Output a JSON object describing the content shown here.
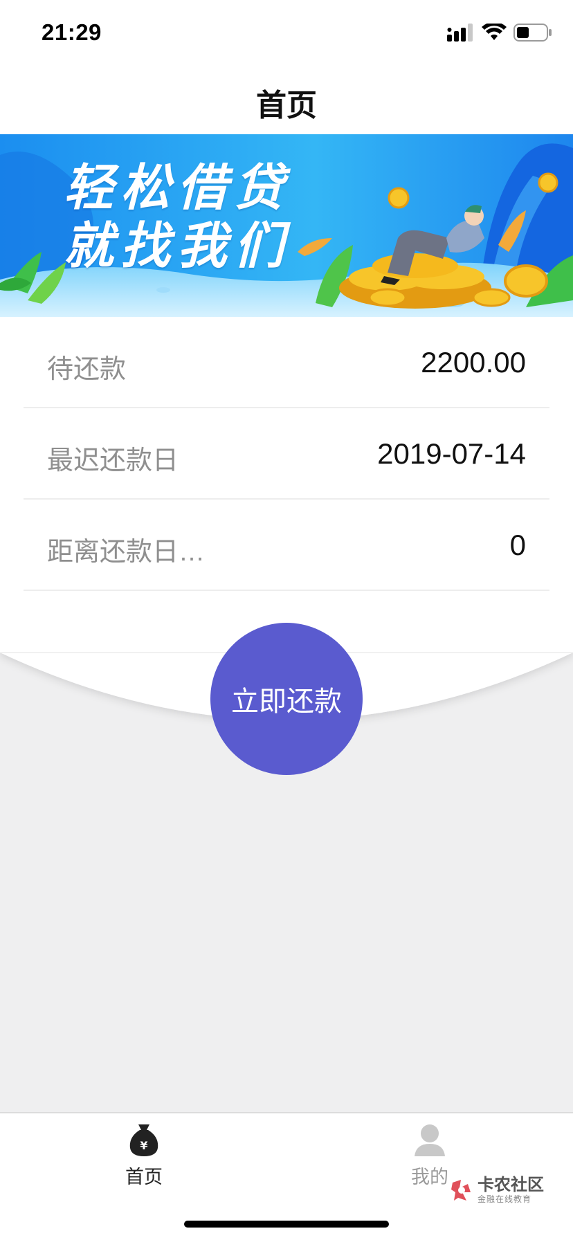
{
  "status_bar": {
    "time": "21:29",
    "icons": [
      "signal-icon",
      "wifi-icon",
      "battery-icon"
    ]
  },
  "nav": {
    "title": "首页"
  },
  "banner": {
    "line1": "轻松借贷",
    "line2": "就找我们"
  },
  "info_rows": [
    {
      "label": "待还款",
      "value": "2200.00"
    },
    {
      "label": "最迟还款日",
      "value": "2019-07-14"
    },
    {
      "label": "距离还款日…",
      "value": "0"
    }
  ],
  "repay_button": {
    "label": "立即还款"
  },
  "tabs": [
    {
      "label": "首页",
      "icon": "money-bag-icon",
      "active": true
    },
    {
      "label": "我的",
      "icon": "user-icon",
      "active": false
    }
  ],
  "watermark": {
    "main": "卡农社区",
    "sub": "金融在线教育"
  },
  "colors": {
    "accent": "#5a5bcf",
    "banner_blue": "#2a9df4",
    "coin_gold": "#f5c21b",
    "tab_active": "#222222",
    "tab_inactive": "#9a9a9a"
  }
}
